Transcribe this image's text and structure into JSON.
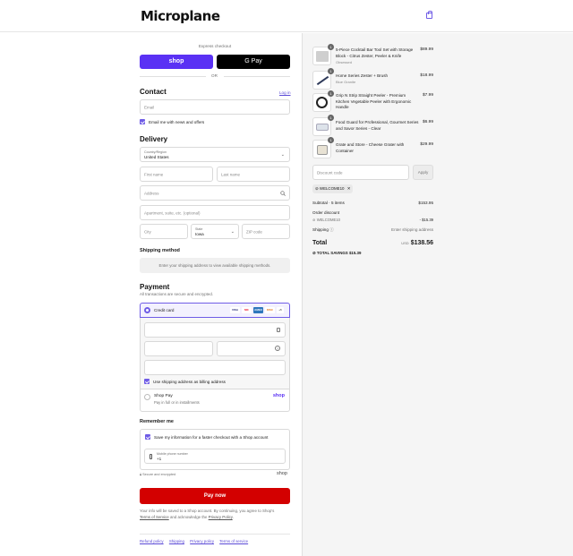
{
  "header": {
    "logo": "Microplane"
  },
  "express": {
    "label": "Express checkout",
    "shop_label": "shop",
    "gpay_label": "G Pay",
    "or_label": "OR"
  },
  "contact": {
    "title": "Contact",
    "login_label": "Log in",
    "email_placeholder": "Email",
    "news_label": "Email me with news and offers"
  },
  "delivery": {
    "title": "Delivery",
    "country_label": "Country/Region",
    "country_value": "United States",
    "first_name_ph": "First name",
    "last_name_ph": "Last name",
    "address_ph": "Address",
    "apt_ph": "Apartment, suite, etc. (optional)",
    "city_ph": "City",
    "state_label": "State",
    "state_value": "Iowa",
    "zip_ph": "ZIP code"
  },
  "shipping_method": {
    "title": "Shipping method",
    "notice": "Enter your shipping address to view available shipping methods."
  },
  "payment": {
    "title": "Payment",
    "subtitle": "All transactions are secure and encrypted.",
    "credit_card_label": "Credit card",
    "cards": [
      "VISA",
      "MC",
      "AMEX",
      "DISC",
      "+5"
    ],
    "billing_label": "Use shipping address as billing address",
    "shoppay_label": "Shop Pay",
    "shoppay_sub": "Pay in full or in installments",
    "shoppay_logo": "shop"
  },
  "remember": {
    "title": "Remember me",
    "save_label": "Save my information for a faster checkout with a Shop account",
    "phone_label": "Mobile phone number",
    "phone_prefix": "+1",
    "secure_label": "Secure and encrypted",
    "shop_logo": "shop"
  },
  "paynow_label": "Pay now",
  "legal": {
    "line1": "Your info will be saved to a Shop account. By continuing, you agree to Shop's",
    "tos": "Terms of Service",
    "and": "and acknowledge the",
    "privacy": "Privacy Policy",
    "dot": "."
  },
  "footer_links": [
    "Refund policy",
    "Shipping",
    "Privacy policy",
    "Terms of service"
  ],
  "cart": {
    "items": [
      {
        "qty": "1",
        "name": "5-Piece Cocktail Bar Tool Set with Storage Block - Citrus Zester, Peeler & Knife",
        "variant": "Obsessed",
        "price": "$89.99"
      },
      {
        "qty": "1",
        "name": "Home Series Zester + Brush",
        "variant": "Blue Granite",
        "price": "$18.99"
      },
      {
        "qty": "1",
        "name": "Grip N Strip Straight Peeler - Premium Kitchen Vegetable Peeler with Ergonomic Handle",
        "variant": "",
        "price": "$7.99"
      },
      {
        "qty": "1",
        "name": "Food Guard for Professional, Gourmet Series and Savor Series - Clear",
        "variant": "",
        "price": "$6.99"
      },
      {
        "qty": "1",
        "name": "Grate and Store - Cheese Grater with Container",
        "variant": "",
        "price": "$29.99"
      }
    ],
    "discount_placeholder": "Discount code",
    "apply_label": "Apply",
    "applied_code": "WELCOME10",
    "subtotal_label": "Subtotal · 5 items",
    "subtotal_value": "$153.95",
    "order_discount_label": "Order discount",
    "discount_code": "WELCOME10",
    "discount_value": "- $15.39",
    "shipping_label": "Shipping",
    "shipping_value": "Enter shipping address",
    "total_label": "Total",
    "currency": "USD",
    "total_value": "$138.56",
    "savings_label": "TOTAL SAVINGS",
    "savings_value": "$15.39"
  }
}
